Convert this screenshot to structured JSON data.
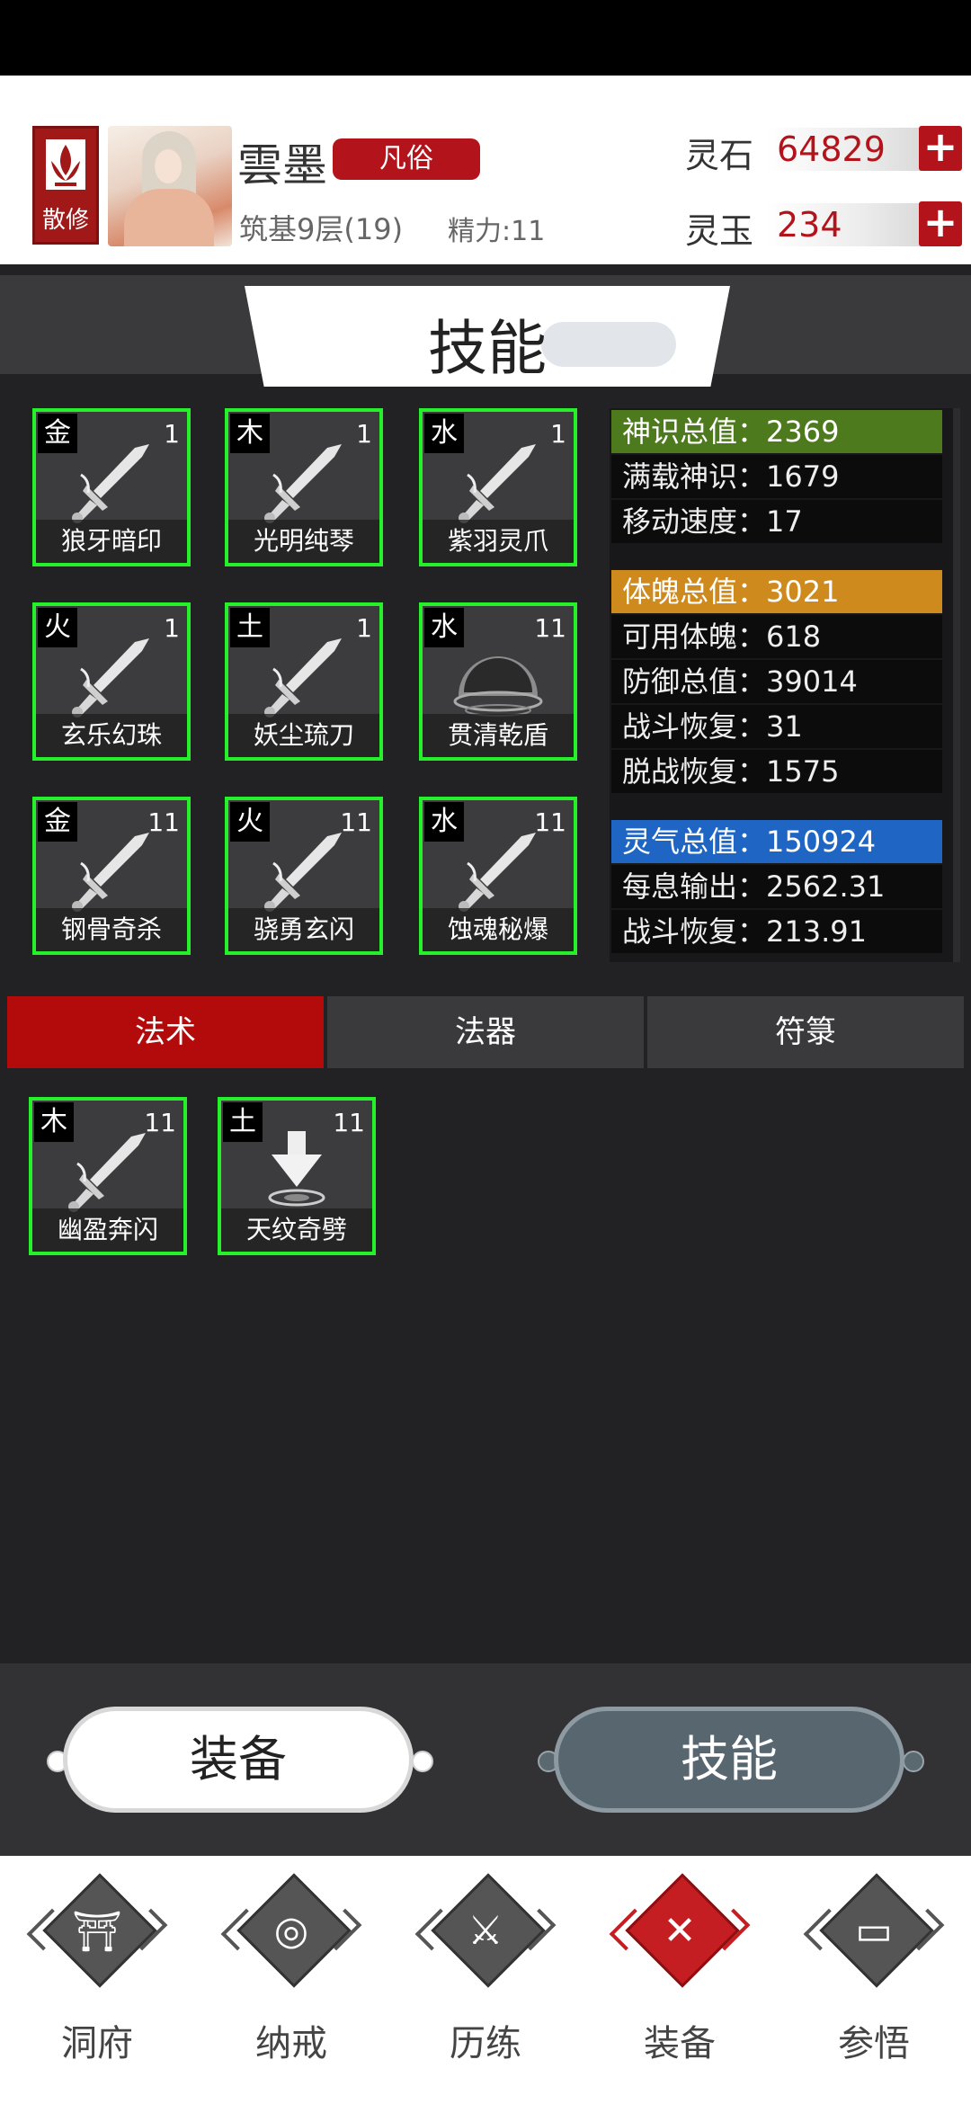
{
  "header": {
    "sect_label": "散修",
    "player_name": "雲墨",
    "rank_badge": "凡俗",
    "realm": "筑基9层(19)",
    "energy": "精力:11",
    "currencies": [
      {
        "label": "灵石",
        "value": "64829",
        "plus": "+"
      },
      {
        "label": "灵玉",
        "value": "234",
        "plus": "+"
      }
    ]
  },
  "title": "技能",
  "equipped_skills": [
    {
      "element": "金",
      "level": "1",
      "name": "狼牙暗印",
      "icon": "sword-icon"
    },
    {
      "element": "木",
      "level": "1",
      "name": "光明纯琴",
      "icon": "sword-icon"
    },
    {
      "element": "水",
      "level": "1",
      "name": "紫羽灵爪",
      "icon": "sword-icon"
    },
    {
      "element": "火",
      "level": "1",
      "name": "玄乐幻珠",
      "icon": "sword-icon"
    },
    {
      "element": "土",
      "level": "1",
      "name": "妖尘琉刀",
      "icon": "sword-icon"
    },
    {
      "element": "水",
      "level": "11",
      "name": "贯清乾盾",
      "icon": "shield-dome-icon"
    },
    {
      "element": "金",
      "level": "11",
      "name": "钢骨奇杀",
      "icon": "sword-icon"
    },
    {
      "element": "火",
      "level": "11",
      "name": "骁勇玄闪",
      "icon": "sword-icon"
    },
    {
      "element": "水",
      "level": "11",
      "name": "蚀魂秘爆",
      "icon": "sword-icon"
    }
  ],
  "stats": {
    "groups": [
      {
        "color": "#4e7a1e",
        "head": "神识总值：2369",
        "rows": [
          "满载神识：1679",
          "移动速度：17"
        ]
      },
      {
        "color": "#cf8a1e",
        "head": "体魄总值：3021",
        "rows": [
          "可用体魄：618",
          "防御总值：39014",
          "战斗恢复：31",
          "脱战恢复：1575"
        ]
      },
      {
        "color": "#1f66c4",
        "head": "灵气总值：150924",
        "rows": [
          "每息输出：2562.31",
          "战斗恢复：213.91"
        ]
      }
    ]
  },
  "tabs": [
    {
      "label": "法术",
      "active": true
    },
    {
      "label": "法器",
      "active": false
    },
    {
      "label": "符箓",
      "active": false
    }
  ],
  "skill_list": [
    {
      "element": "木",
      "level": "11",
      "name": "幽盈奔闪",
      "icon": "sword-icon"
    },
    {
      "element": "土",
      "level": "11",
      "name": "天纹奇劈",
      "icon": "ground-strike-icon"
    }
  ],
  "switch": {
    "left": "装备",
    "right": "技能"
  },
  "colors": {
    "accent": "#b3141c",
    "card_border": "#25f02a"
  },
  "nav": [
    {
      "label": "洞府",
      "icon": "gate-icon",
      "active": false
    },
    {
      "label": "纳戒",
      "icon": "ring-icon",
      "active": false
    },
    {
      "label": "历练",
      "icon": "crossed-swords-icon",
      "active": false
    },
    {
      "label": "装备",
      "icon": "equipment-icon",
      "active": true
    },
    {
      "label": "参悟",
      "icon": "book-icon",
      "active": false
    }
  ]
}
